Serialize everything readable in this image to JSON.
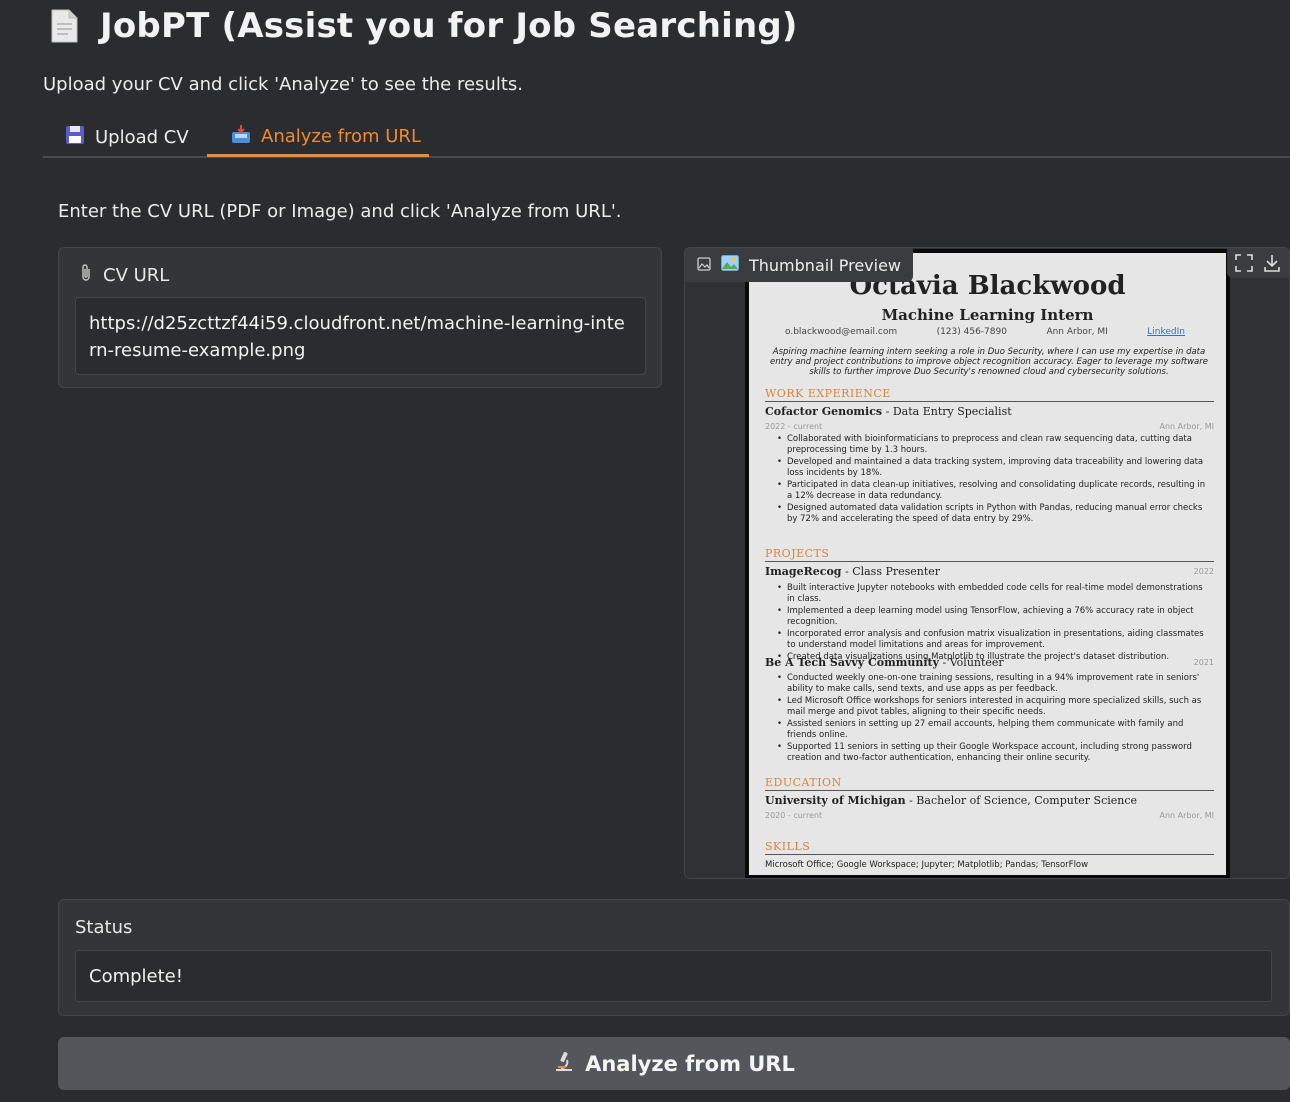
{
  "app": {
    "title": "JobPT (Assist you for Job Searching)",
    "subtitle": "Upload your CV and click 'Analyze' to see the results."
  },
  "tabs": [
    {
      "label": "Upload CV",
      "icon": "floppy-disk-icon",
      "active": false
    },
    {
      "label": "Analyze from URL",
      "icon": "inbox-tray-icon",
      "active": true
    }
  ],
  "colors": {
    "accent": "#f08a32",
    "background": "#2b2c2f",
    "panel": "#343538"
  },
  "url_tab": {
    "instructions": "Enter the CV URL (PDF or Image) and click 'Analyze from URL'.",
    "cv_url_label": "CV URL",
    "cv_url_value": "https://d25zcttzf44i59.cloudfront.net/machine-learning-intern-resume-example.png",
    "preview_label": "Thumbnail Preview"
  },
  "resume": {
    "name": "Octavia Blackwood",
    "role": "Machine Learning Intern",
    "email": "o.blackwood@email.com",
    "phone": "(123) 456-7890",
    "location": "Ann Arbor, MI",
    "linkedin": "LinkedIn",
    "summary": "Aspiring machine learning intern seeking a role in Duo Security, where I can use my expertise in data entry and project contributions to improve object recognition accuracy. Eager to leverage my software skills to further improve Duo Security's renowned cloud and cybersecurity solutions.",
    "sections": {
      "work": "WORK EXPERIENCE",
      "projects": "PROJECTS",
      "education": "EDUCATION",
      "skills": "SKILLS"
    },
    "job1": {
      "company": "Cofactor Genomics",
      "title": "Data Entry Specialist",
      "dates": "2022 - current",
      "location": "Ann Arbor, MI",
      "bullets": [
        "Collaborated with bioinformaticians to preprocess and clean raw sequencing data, cutting data preprocessing time by 1.3 hours.",
        "Developed and maintained a data tracking system, improving data traceability and lowering data loss incidents by 18%.",
        "Participated in data clean-up initiatives, resolving and consolidating duplicate records, resulting in a 12% decrease in data redundancy.",
        "Designed automated data validation scripts in Python with Pandas, reducing manual error checks by 72% and accelerating the speed of data entry by 29%."
      ]
    },
    "project1": {
      "name": "ImageRecog",
      "role": "Class Presenter",
      "year": "2022",
      "bullets": [
        "Built interactive Jupyter notebooks with embedded code cells for real-time model demonstrations in class.",
        "Implemented a deep learning model using TensorFlow, achieving a 76% accuracy rate in object recognition.",
        "Incorporated error analysis and confusion matrix visualization in presentations, aiding classmates to understand model limitations and areas for improvement.",
        "Created data visualizations using Matplotlib to illustrate the project's dataset distribution."
      ]
    },
    "project2": {
      "name": "Be A Tech Savvy Community",
      "role": "Volunteer",
      "year": "2021",
      "bullets": [
        "Conducted weekly one-on-one training sessions, resulting in a 94% improvement rate in seniors' ability to make calls, send texts, and use apps as per feedback.",
        "Led Microsoft Office workshops for seniors interested in acquiring more specialized skills, such as mail merge and pivot tables, aligning to their specific needs.",
        "Assisted seniors in setting up 27 email accounts, helping them communicate with family and friends online.",
        "Supported 11 seniors in setting up their Google Workspace account, including strong password creation and two-factor authentication, enhancing their online security."
      ]
    },
    "education": {
      "school": "University of Michigan",
      "degree": "Bachelor of Science, Computer Science",
      "dates": "2020 - current",
      "location": "Ann Arbor, MI"
    },
    "skills": "Microsoft Office; Google Workspace; Jupyter; Matplotlib; Pandas; TensorFlow"
  },
  "status": {
    "label": "Status",
    "value": "Complete!"
  },
  "analyze_button": {
    "label": "Analyze from URL",
    "icon": "microscope-icon"
  }
}
